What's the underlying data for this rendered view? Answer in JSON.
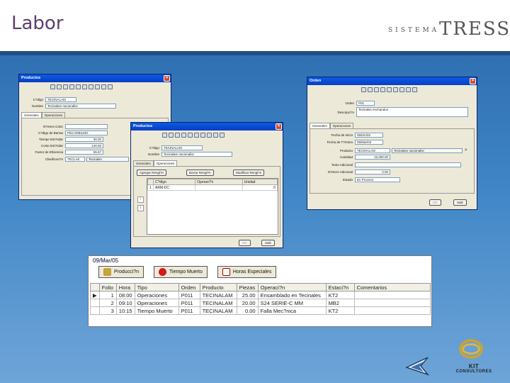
{
  "slide": {
    "title": "Labor",
    "brand_prefix": "SISTEMA",
    "brand_name": "TRESS",
    "footer_brand": "KIT",
    "footer_brand_sub": "CONSULTORES"
  },
  "productos_back": {
    "title": "Productos",
    "labels": {
      "codigo": "C?digo",
      "nombre": "Nombre",
      "numero_color": "N?mero Color",
      "codigo_barras": "C?digo de Barras",
      "tiempo": "Tiempo Est?ndar",
      "costo": "Costo Est?ndar",
      "eficiencia": "Factor de Eficiencia",
      "clasificacion": "Clasificaci?n"
    },
    "values": {
      "codigo": "TECINALAM",
      "nombre": "Tecinalam nacionalisr",
      "codigo_barras": "PECARBILMO",
      "tiempo": "30.00",
      "costo": "140.00",
      "eficiencia": "55.57",
      "clasificacion": "TECLAE",
      "clasificacion_desc": "Tecinales"
    },
    "tabs": [
      "Generales",
      "Operaciones"
    ]
  },
  "productos_front": {
    "title": "Productos",
    "labels": {
      "codigo": "C?digo",
      "nombre": "Nombre"
    },
    "values": {
      "codigo": "TECINALAM",
      "nombre": "Tecinalam nacionalisr"
    },
    "tabs": [
      "Generales",
      "Operaciones"
    ],
    "buttons": [
      "Agregar Rengl?n",
      "Borrar Rengl?n",
      "Modificar Rengl?n"
    ],
    "grid_headers": [
      "C?digo",
      "Operaci?n",
      "Unidad"
    ],
    "grid_rows": [
      [
        "1",
        "ARM-DC",
        "",
        "0"
      ]
    ],
    "ok": "Salir",
    "cancel": "OK"
  },
  "orden": {
    "title": "Orden",
    "labels": {
      "orden": "Orden",
      "descripcion": "Descripci?n",
      "fecha_inicio": "Fecha de Inicio",
      "fecha_termino": "Fecha de T?rmino",
      "producto": "Producto",
      "cantidad": "Cantidad",
      "texto_adicional": "Texto Adicional",
      "numero_adicional": "N?mero Adicional",
      "estado": "Estado"
    },
    "values": {
      "orden": "P01",
      "descripcion": "Tecinales enchandos",
      "fecha_inicio": "05/Dic/02",
      "fecha_termino": "05/Mar/03",
      "producto": "TECINALAM",
      "producto_desc": "Tecinalam nacionalisr",
      "cantidad": "15,000.00",
      "numero_adicional": "0.00",
      "estado": "En Proceso"
    },
    "tabs": [
      "Generales",
      "Operaciones"
    ],
    "ok": "Salir",
    "cancel": "OK"
  },
  "labor": {
    "date": "09/Mar/05",
    "buttons": [
      "Producci?n",
      "Tiempo Muerto",
      "Horas Especiales"
    ],
    "headers": [
      "Folio",
      "Hora",
      "Tipo",
      "Orden",
      "Producto",
      "Piezas",
      "Operaci?n",
      "Estaci?n",
      "Comentarios"
    ],
    "rows": [
      [
        "1",
        "08:00",
        "Operaciones",
        "P011",
        "TECINALAM",
        "25.00",
        "Ensamblado en Tecinales",
        "KT2",
        ""
      ],
      [
        "2",
        "09:10",
        "Operaciones",
        "P011",
        "TECINALAM",
        "20.00",
        "S24 SERIE-C MM",
        "MB2",
        ""
      ],
      [
        "3",
        "10:15",
        "Tiempo Muerto",
        "P011",
        "TECINALAM",
        "0.00",
        "Falla Mec?nica",
        "KT2",
        ""
      ]
    ]
  },
  "colors": {
    "titlebar": "#0a4fd4",
    "window_face": "#ece9d8",
    "band": "#3f85c6",
    "brand_accent": "#8a3a7d"
  }
}
